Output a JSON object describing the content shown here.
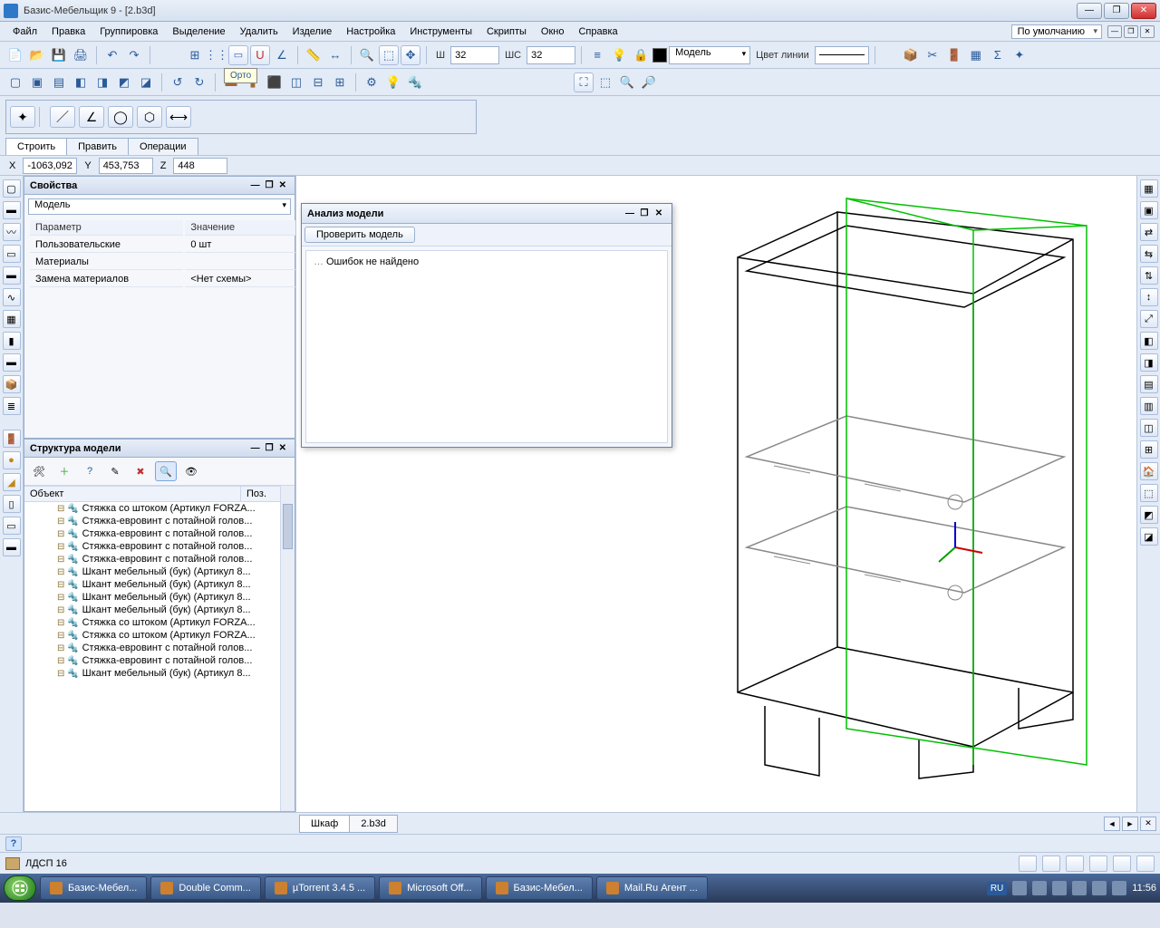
{
  "window": {
    "title": "Базис-Мебельщик 9 - [2.b3d]",
    "menu": [
      "Файл",
      "Правка",
      "Группировка",
      "Выделение",
      "Удалить",
      "Изделие",
      "Настройка",
      "Инструменты",
      "Скрипты",
      "Окно",
      "Справка"
    ],
    "preset_label": "По умолчанию"
  },
  "toolbar": {
    "tooltip": "Орто",
    "w_label": "Ш",
    "w_value": "32",
    "ws_label": "ШС",
    "ws_value": "32",
    "model_label": "Модель",
    "linecolor_label": "Цвет линии"
  },
  "tool_panel": {
    "tabs": [
      "Строить",
      "Править",
      "Операции"
    ],
    "active_tab": 0
  },
  "coords": {
    "x_label": "X",
    "x": "-1063,092",
    "y_label": "Y",
    "y": "453,753",
    "z_label": "Z",
    "z": "448"
  },
  "props_panel": {
    "title": "Свойства",
    "model_dd": "Модель",
    "columns": [
      "Параметр",
      "Значение"
    ],
    "rows": [
      {
        "param": "Пользовательские",
        "value": "0 шт"
      },
      {
        "param": "Материалы",
        "value": ""
      },
      {
        "param": "Замена материалов",
        "value": "<Нет схемы>"
      }
    ]
  },
  "struct_panel": {
    "title": "Структура модели",
    "columns": [
      "Объект",
      "Поз."
    ],
    "items": [
      "Стяжка со штоком (Артикул FORZA...",
      "Стяжка-евровинт с потайной голов...",
      "Стяжка-евровинт с потайной голов...",
      "Стяжка-евровинт с потайной голов...",
      "Стяжка-евровинт с потайной голов...",
      "Шкант мебельный (бук) (Артикул 8...",
      "Шкант мебельный (бук) (Артикул 8...",
      "Шкант мебельный (бук) (Артикул 8...",
      "Шкант мебельный (бук) (Артикул 8...",
      "Стяжка со штоком (Артикул FORZA...",
      "Стяжка со штоком (Артикул FORZA...",
      "Стяжка-евровинт с потайной голов...",
      "Стяжка-евровинт с потайной голов...",
      "Шкант мебельный (бук) (Артикул 8..."
    ]
  },
  "analysis": {
    "title": "Анализ модели",
    "button": "Проверить модель",
    "message": "Ошибок не найдено"
  },
  "doc_tabs": {
    "tabs": [
      "Шкаф",
      "2.b3d"
    ],
    "active": 1
  },
  "status": {
    "material": "ЛДСП 16"
  },
  "taskbar": {
    "tasks": [
      "Базис-Мебел...",
      "Double Comm...",
      "µTorrent 3.4.5 ...",
      "Microsoft Off...",
      "Базис-Мебел...",
      "Mail.Ru Агент ..."
    ],
    "lang": "RU",
    "time": "11:56"
  }
}
